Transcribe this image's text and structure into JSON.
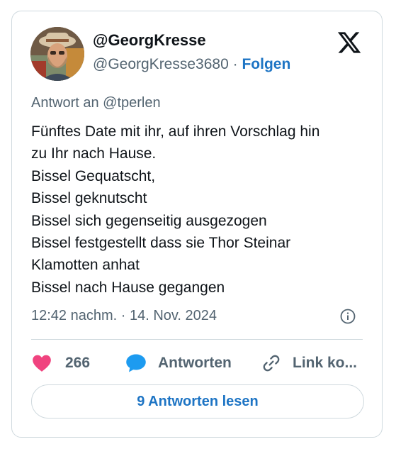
{
  "author": {
    "display_name": "@GeorgKresse",
    "handle": "@GeorgKresse3680",
    "separator": "·",
    "follow_label": "Folgen"
  },
  "reply_to": "Antwort an @tperlen",
  "tweet_text": "Fünftes Date mit ihr, auf ihren Vorschlag hin\nzu Ihr nach Hause.\nBissel Gequatscht,\nBissel geknutscht\nBissel sich gegenseitig ausgezogen\nBissel festgestellt dass sie Thor Steinar\nKlamotten anhat\nBissel nach Hause gegangen",
  "timestamp": "12:42 nachm. · 14. Nov. 2024",
  "actions": {
    "like_count": "266",
    "reply_label": "Antworten",
    "link_label": "Link ko..."
  },
  "read_replies_label": "9 Antworten lesen",
  "colors": {
    "accent": "#1d74c4",
    "like": "#f0437f",
    "secondary_text": "#536471",
    "border": "#cfd9de"
  },
  "icons": [
    "x-logo-icon",
    "info-icon",
    "heart-icon",
    "speech-bubble-icon",
    "link-icon"
  ]
}
